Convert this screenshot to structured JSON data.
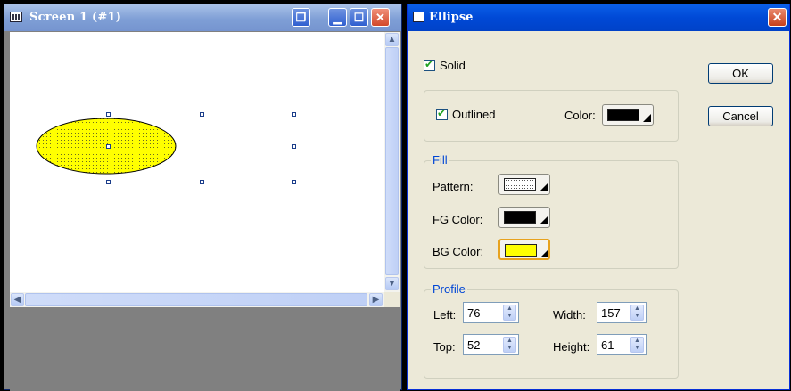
{
  "screen_window": {
    "title": "Screen 1 (#1)",
    "controls": {
      "restore": "❐",
      "minimize": "▁",
      "maximize": "☐",
      "close": "✕"
    },
    "ellipse_fill_color": "#ffff00",
    "ellipse_outline_color": "#000000"
  },
  "dialog": {
    "title": "Ellipse",
    "close_symbol": "✕",
    "solid": {
      "label": "Solid",
      "checked": true
    },
    "ok_label": "OK",
    "cancel_label": "Cancel",
    "outlined": {
      "label": "Outlined",
      "checked": true
    },
    "outline_color_label": "Color:",
    "outline_color": "#000000",
    "fill": {
      "legend": "Fill",
      "pattern_label": "Pattern:",
      "fg_label": "FG Color:",
      "fg_color": "#000000",
      "bg_label": "BG Color:",
      "bg_color": "#ffff00"
    },
    "profile": {
      "legend": "Profile",
      "left_label": "Left:",
      "left_value": "76",
      "top_label": "Top:",
      "top_value": "52",
      "width_label": "Width:",
      "width_value": "157",
      "height_label": "Height:",
      "height_value": "61"
    }
  }
}
